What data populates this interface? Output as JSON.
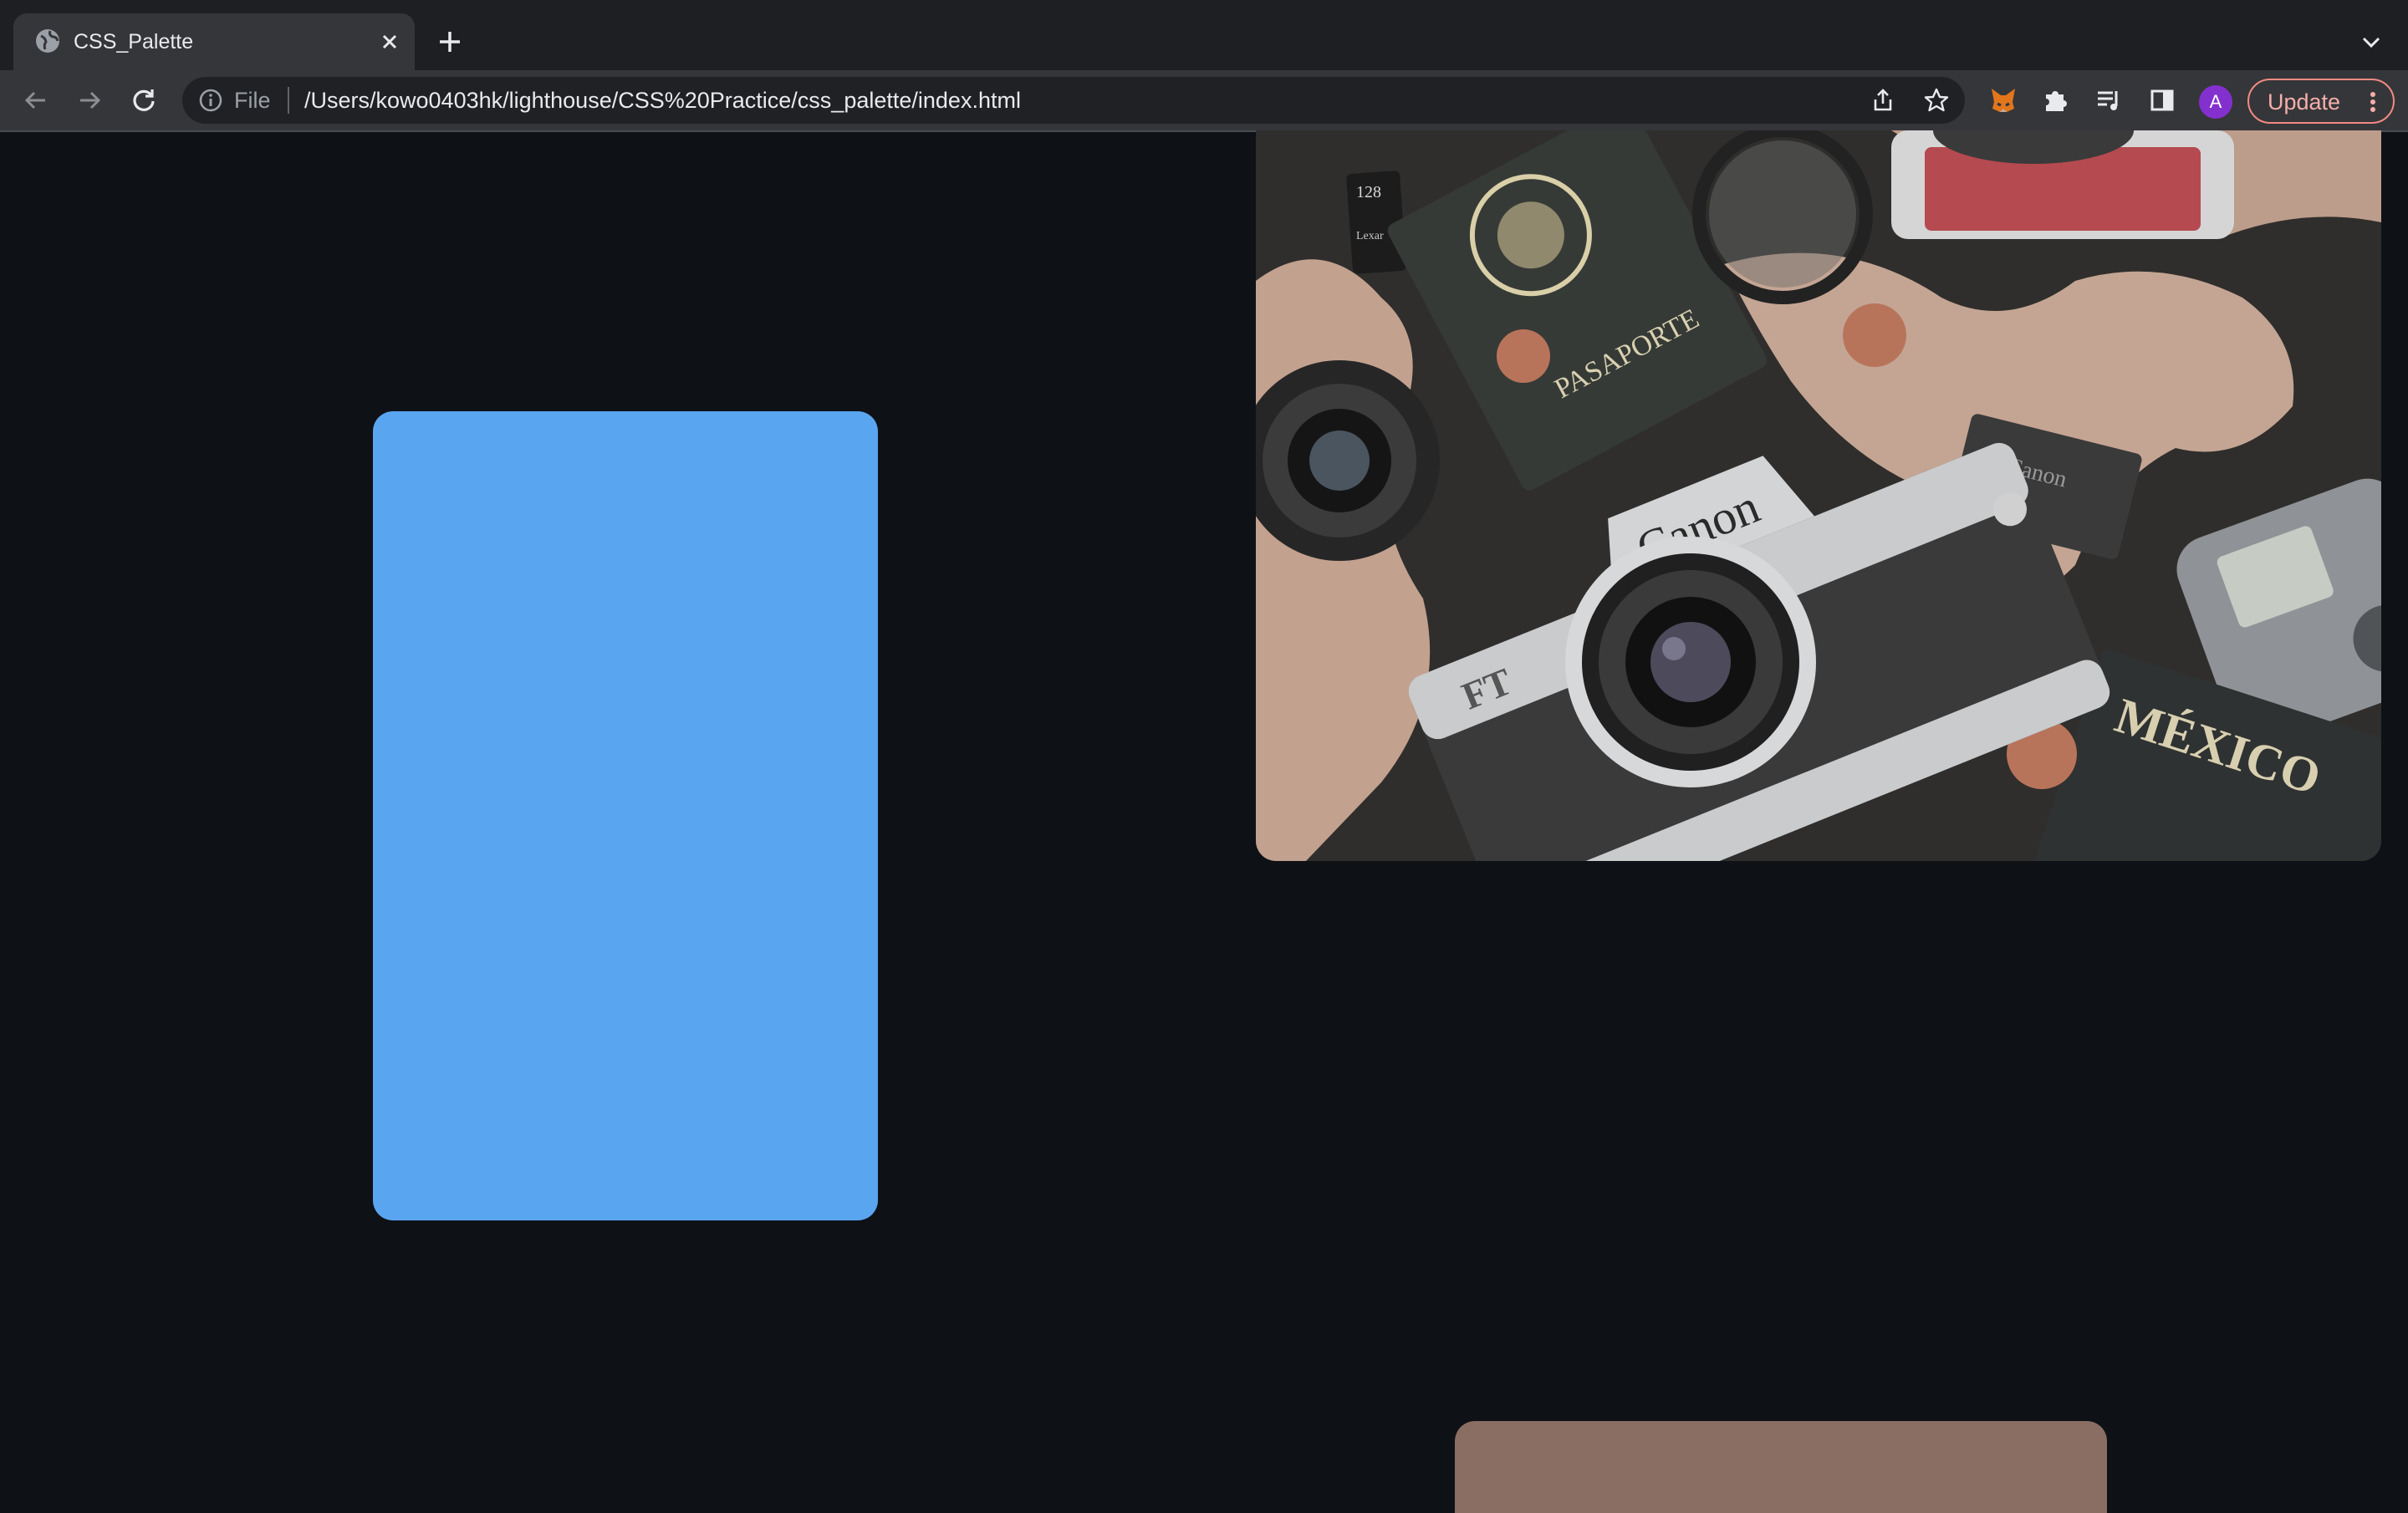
{
  "browser": {
    "tab": {
      "title": "CSS_Palette",
      "favicon": "globe-icon"
    },
    "omnibox": {
      "scheme_label": "File",
      "url": "/Users/kowo0403hk/lighthouse/CSS%20Practice/css_palette/index.html"
    },
    "profile_initial": "A",
    "update_label": "Update",
    "colors": {
      "tab_bg": "#35363a",
      "frame_bg": "#1e1f22",
      "update_accent": "#f28b82",
      "avatar": "#8430ce"
    }
  },
  "page": {
    "background_color": "#0e1116",
    "blue_card_color": "#5aa5f0",
    "brown_card_color": "#8a6d63",
    "photo": {
      "description_icon": "camera-flatlay-image",
      "labels": {
        "camera_brand": "Canon",
        "camera_model": "FT",
        "battery_brand": "Canon",
        "passport_top": "PASAPORTE",
        "passport_bottom": "MÉXICO",
        "sd_card": "128",
        "sd_brand": "Lexar"
      }
    }
  }
}
